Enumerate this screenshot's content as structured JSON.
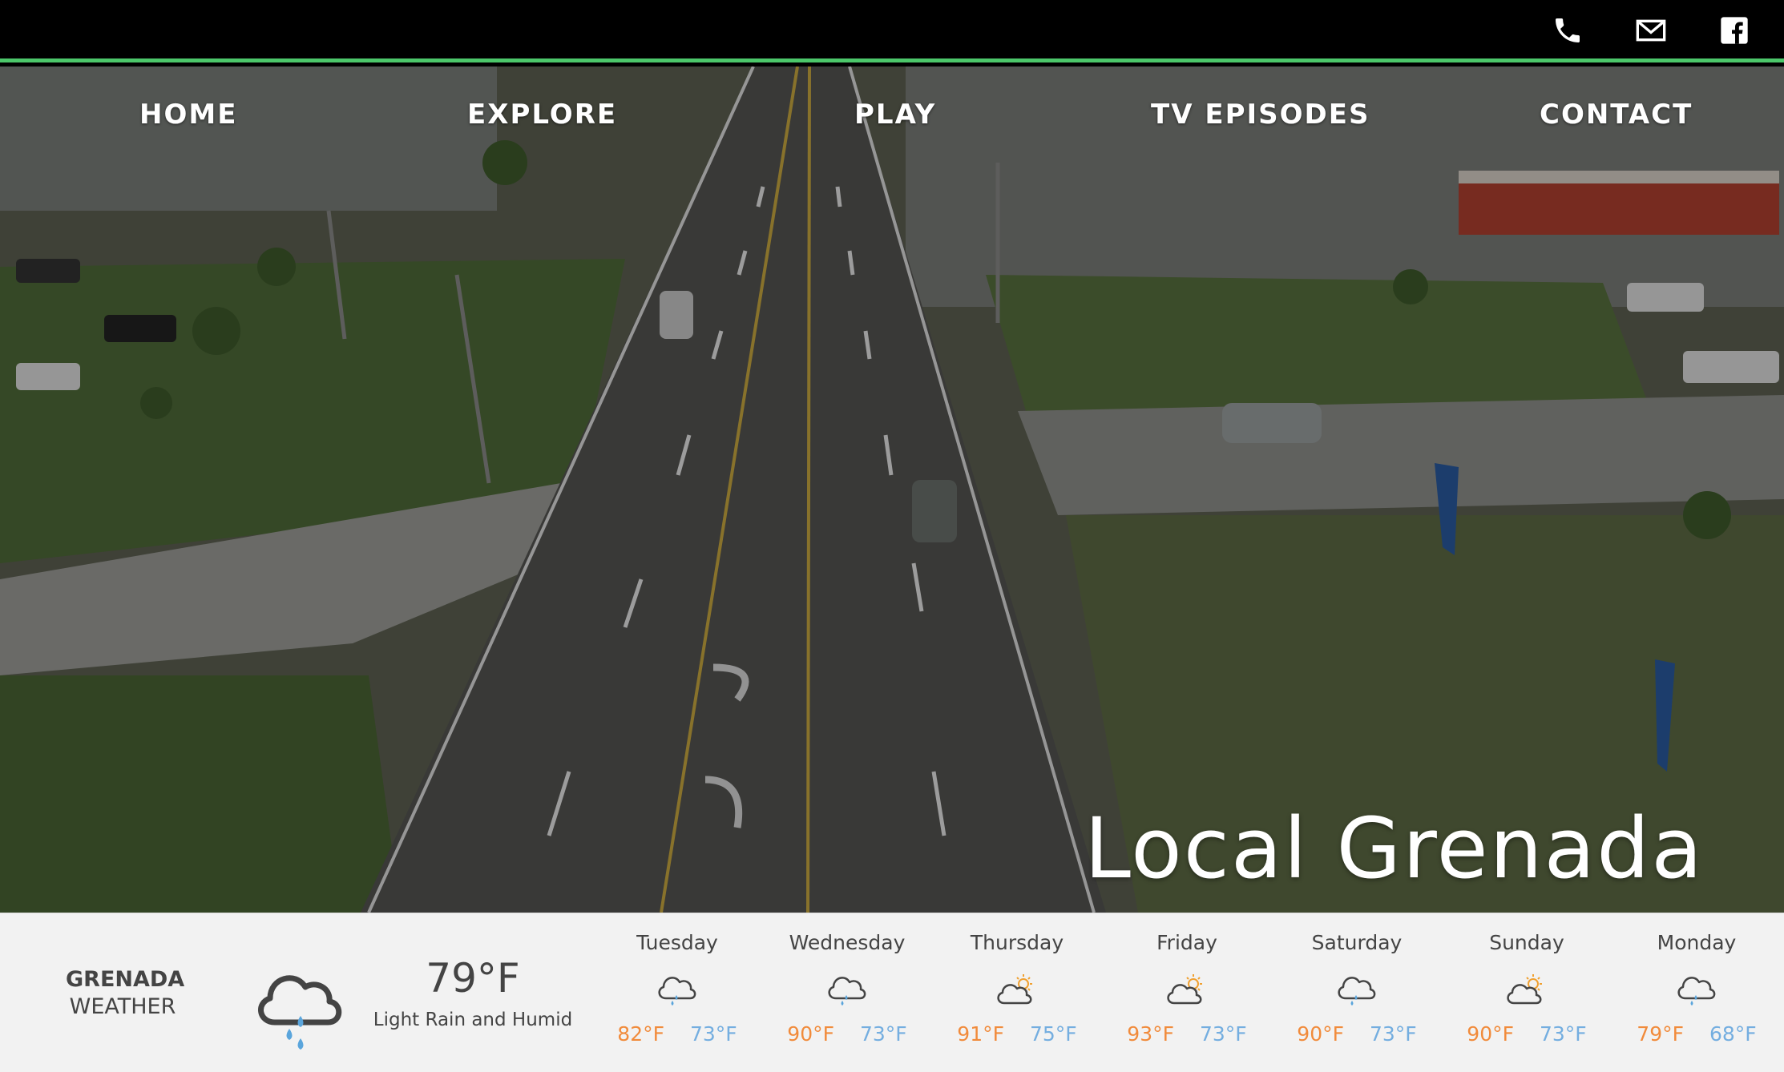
{
  "nav": {
    "items": [
      {
        "label": "HOME"
      },
      {
        "label": "EXPLORE"
      },
      {
        "label": "PLAY"
      },
      {
        "label": "TV EPISODES"
      },
      {
        "label": "CONTACT"
      }
    ]
  },
  "topbar": {
    "icons": [
      "phone-icon",
      "mail-icon",
      "facebook-icon"
    ]
  },
  "hero": {
    "title": "Local Grenada"
  },
  "weather": {
    "city": "GRENADA",
    "label": "WEATHER",
    "current_temp": "79°F",
    "current_condition": "Light Rain and Humid",
    "current_icon": "rain-cloud-icon",
    "days": [
      {
        "name": "Tuesday",
        "icon": "rain-cloud-icon",
        "hi": "82°F",
        "lo": "73°F"
      },
      {
        "name": "Wednesday",
        "icon": "rain-cloud-icon",
        "hi": "90°F",
        "lo": "73°F"
      },
      {
        "name": "Thursday",
        "icon": "partly-sunny-icon",
        "hi": "91°F",
        "lo": "75°F"
      },
      {
        "name": "Friday",
        "icon": "partly-sunny-icon",
        "hi": "93°F",
        "lo": "73°F"
      },
      {
        "name": "Saturday",
        "icon": "rain-cloud-icon",
        "hi": "90°F",
        "lo": "73°F"
      },
      {
        "name": "Sunday",
        "icon": "partly-sunny-icon",
        "hi": "90°F",
        "lo": "73°F"
      },
      {
        "name": "Monday",
        "icon": "rain-cloud-icon",
        "hi": "79°F",
        "lo": "68°F"
      }
    ],
    "colors": {
      "hi": "#f18b3b",
      "lo": "#74aee0",
      "sun": "#f0a030",
      "rain": "#5aa5dc"
    }
  }
}
